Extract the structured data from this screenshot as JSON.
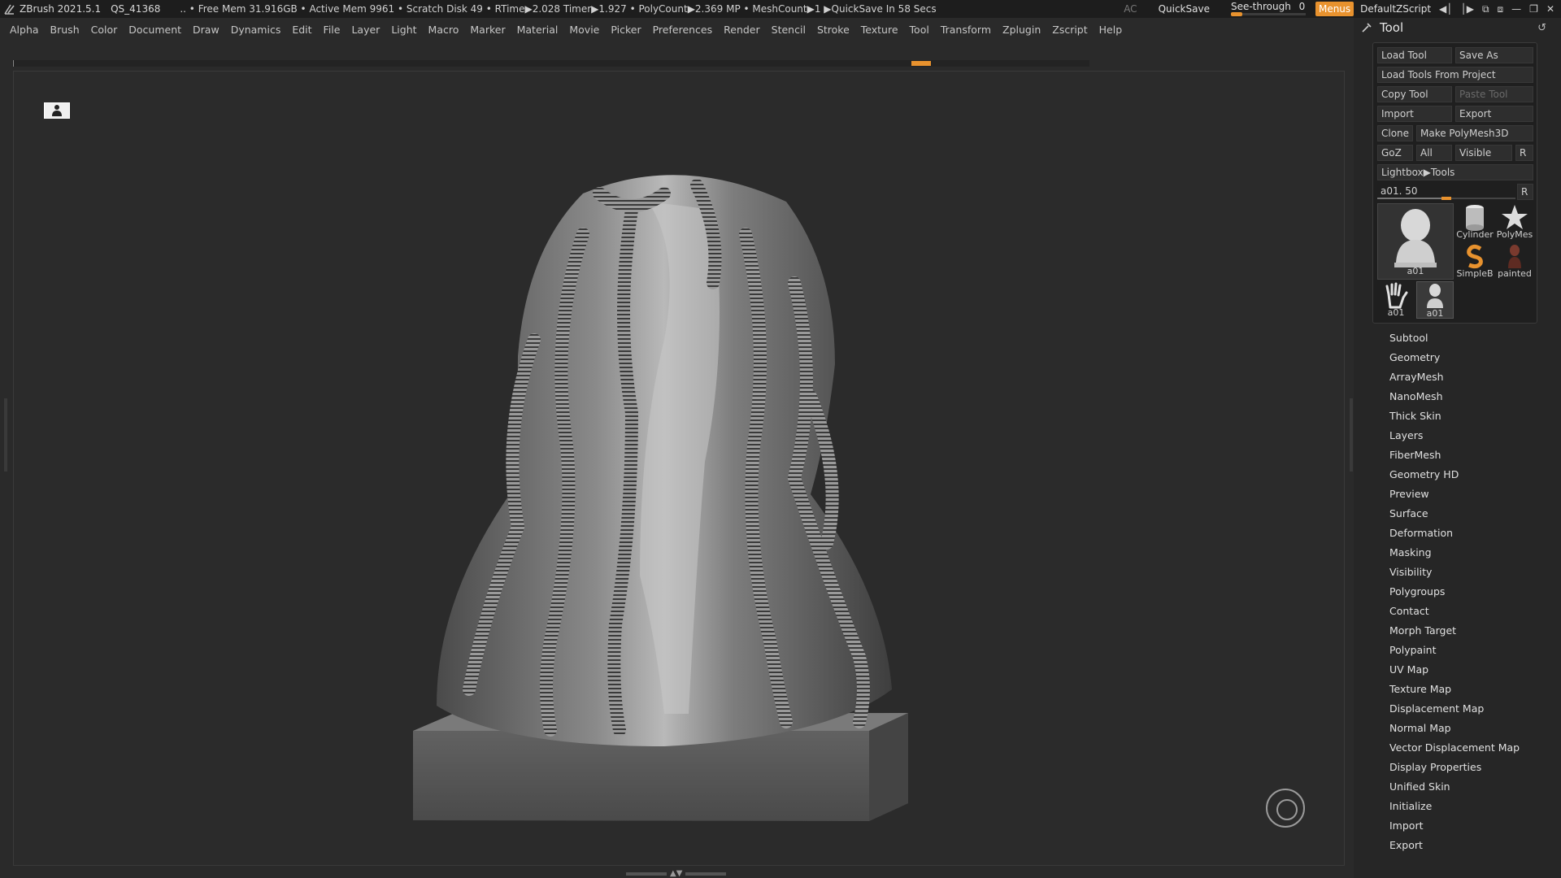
{
  "titlebar": {
    "app": "ZBrush 2021.5.1",
    "qs": "QS_41368",
    "status": "..  • Free Mem 31.916GB • Active Mem 9961 • Scratch Disk 49 •  RTime▶2.028 Timer▶1.927 • PolyCount▶2.369 MP  • MeshCount▶1  ▶QuickSave In 58 Secs",
    "ac": "AC",
    "quicksave": "QuickSave",
    "see_through_label": "See-through",
    "see_through_value": "0",
    "see_through_level": 0,
    "menus": "Menus",
    "default_zscript": "DefaultZScript"
  },
  "menubar": {
    "items": [
      "Alpha",
      "Brush",
      "Color",
      "Document",
      "Draw",
      "Dynamics",
      "Edit",
      "File",
      "Layer",
      "Light",
      "Macro",
      "Marker",
      "Material",
      "Movie",
      "Picker",
      "Preferences",
      "Render",
      "Stencil",
      "Stroke",
      "Texture",
      "Tool",
      "Transform",
      "Zplugin",
      "Zscript",
      "Help"
    ]
  },
  "panel": {
    "title": "Tool",
    "buttons": {
      "load_tool": "Load Tool",
      "save_as": "Save As",
      "load_from_project": "Load Tools From Project",
      "copy_tool": "Copy Tool",
      "paste_tool": "Paste Tool",
      "import": "Import",
      "export": "Export",
      "clone": "Clone",
      "make_polymesh": "Make PolyMesh3D",
      "goz": "GoZ",
      "all": "All",
      "visible": "Visible",
      "r": "R",
      "lightbox": "Lightbox▶Tools"
    },
    "slider": {
      "label": "a01. 50",
      "value": 50,
      "r": "R"
    },
    "thumbs": {
      "a01_big": "a01",
      "cylinder": "Cylinder",
      "polymesh": "PolyMes",
      "simpleb": "SimpleB",
      "painted": "painted",
      "hand": "a01",
      "bust_small": "a01"
    },
    "subpalettes": [
      "Subtool",
      "Geometry",
      "ArrayMesh",
      "NanoMesh",
      "Thick Skin",
      "Layers",
      "FiberMesh",
      "Geometry HD",
      "Preview",
      "Surface",
      "Deformation",
      "Masking",
      "Visibility",
      "Polygroups",
      "Contact",
      "Morph Target",
      "Polypaint",
      "UV Map",
      "Texture Map",
      "Displacement Map",
      "Normal Map",
      "Vector Displacement Map",
      "Display Properties",
      "Unified Skin",
      "Initialize",
      "Import",
      "Export"
    ]
  },
  "colors": {
    "accent": "#e8922e",
    "panel_bg": "#262626",
    "canvas_bg": "#2b2b2b"
  }
}
